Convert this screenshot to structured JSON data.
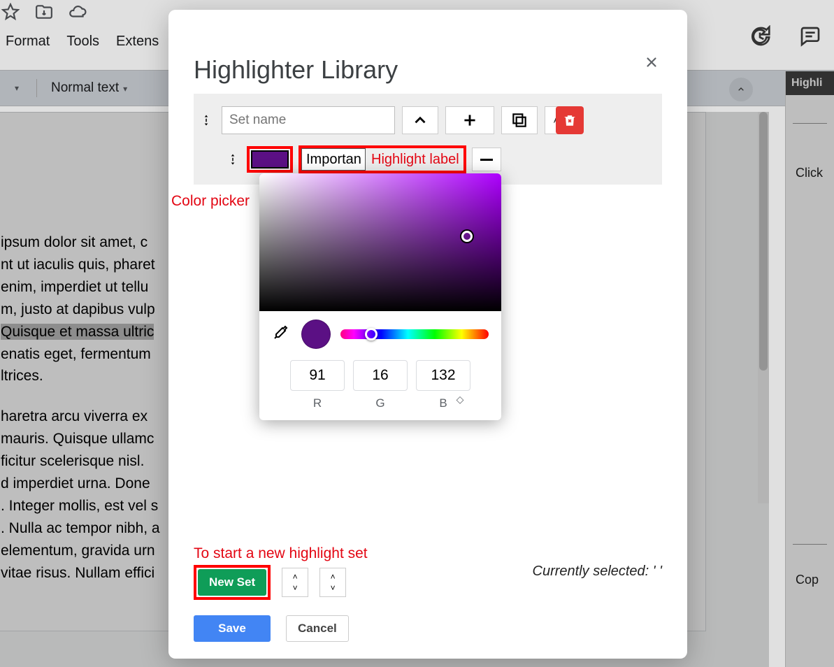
{
  "menus": {
    "format": "Format",
    "tools": "Tools",
    "extens": "Extens"
  },
  "toolbar": {
    "style_dropdown": "Normal text"
  },
  "right_panel": {
    "tab_label": "Highli",
    "click_text": "Click",
    "copy_text": "Cop"
  },
  "document_body": {
    "p1_a": "ipsum dolor sit amet, c",
    "p1_b": "nt ut iaculis quis, pharet",
    "p1_c": "enim, imperdiet ut tellu",
    "p1_d": "m, justo at dapibus vulp",
    "p1_e": "Quisque et massa ultric",
    "p1_f": "enatis eget, fermentum ",
    "p1_g": "ltrices.",
    "p2_a": "haretra arcu viverra ex ",
    "p2_b": " mauris. Quisque ullamc",
    "p2_c": "ficitur scelerisque nisl.  ",
    "p2_d": "d imperdiet urna. Done",
    "p2_e": ". Integer mollis, est vel s",
    "p2_f": ". Nulla ac tempor nibh, a",
    "p2_g": "elementum, gravida urn",
    "p2_h": " vitae risus. Nullam effici"
  },
  "modal": {
    "title": "Highlighter Library",
    "set_name_placeholder": "Set name",
    "highlight_label_value": "Important",
    "new_set": "New Set",
    "save": "Save",
    "cancel": "Cancel",
    "currently_selected": "Currently selected: ' '"
  },
  "annotations": {
    "color_picker": "Color picker",
    "highlight_label": "Highlight label",
    "new_set_hint": "To start a new highlight set"
  },
  "color_picker": {
    "swatch_hex": "#5b1084",
    "r": "91",
    "g": "16",
    "b": "132",
    "r_label": "R",
    "g_label": "G",
    "b_label": "B"
  }
}
